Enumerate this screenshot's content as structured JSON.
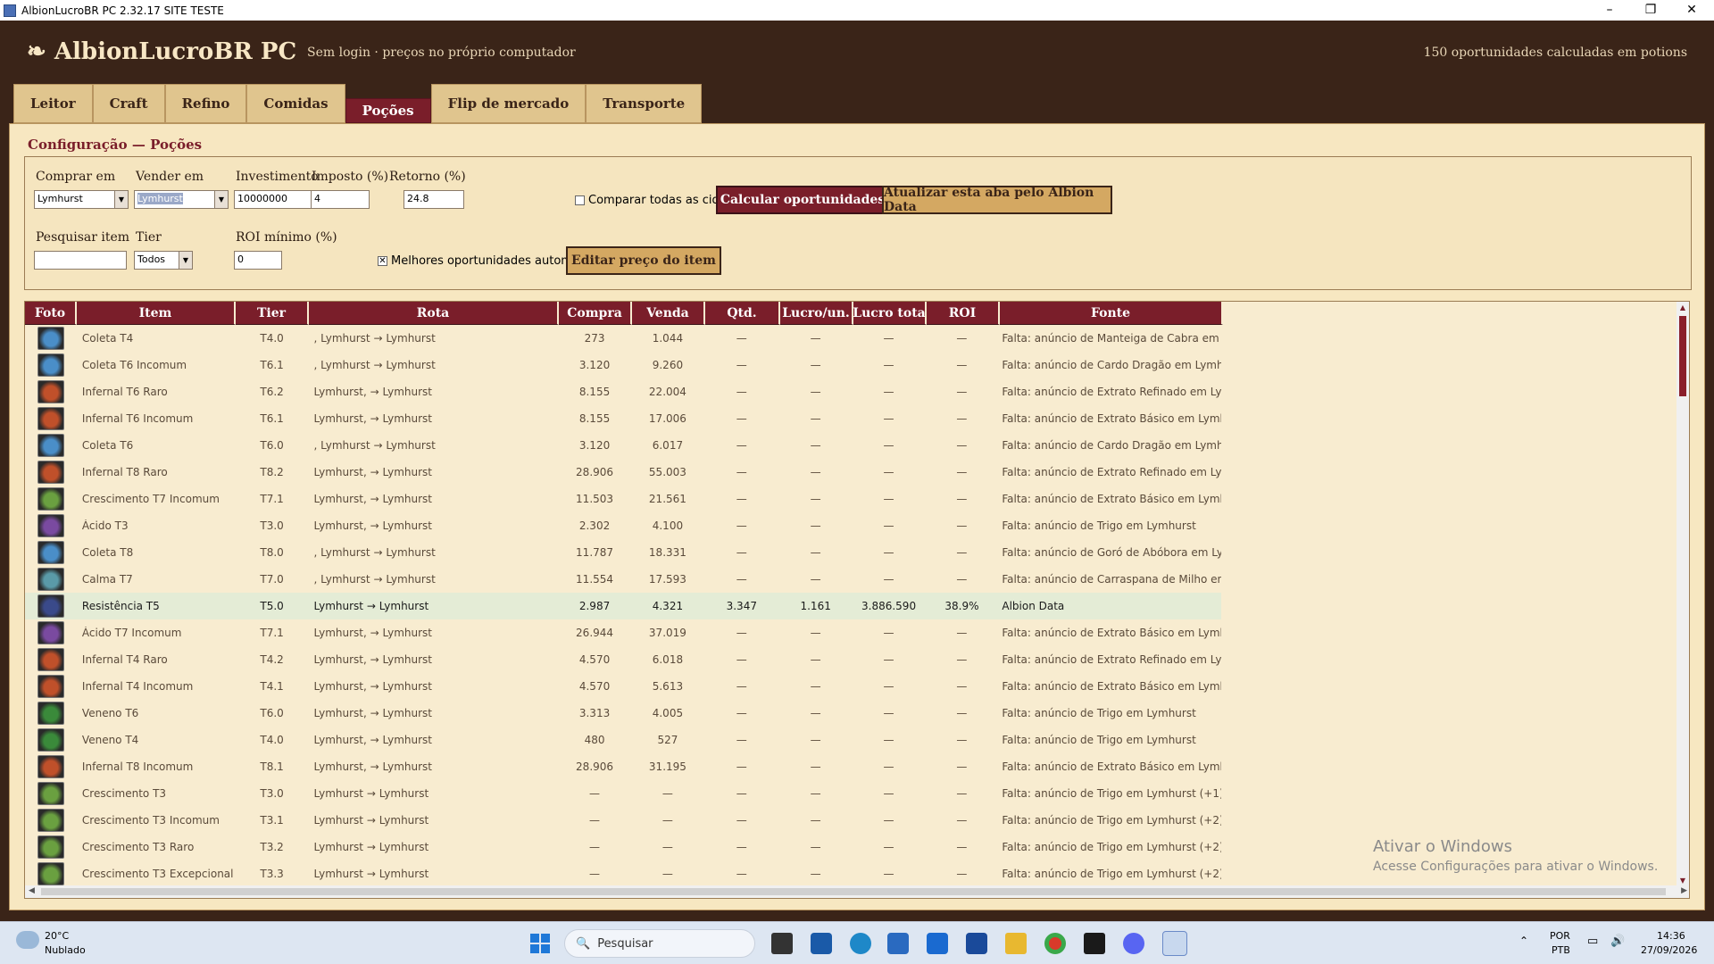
{
  "window": {
    "title": "AlbionLucroBR PC 2.32.17 SITE TESTE"
  },
  "header": {
    "logo": "AlbionLucroBR PC",
    "subtitle": "Sem login · preços no próprio computador",
    "count": "150 oportunidades calculadas em potions"
  },
  "tabs": [
    "Leitor",
    "Craft",
    "Refino",
    "Comidas",
    "Poções",
    "Flip de mercado",
    "Transporte"
  ],
  "active_tab": "Poções",
  "config": {
    "title": "Configuração — Poções",
    "buy_label": "Comprar em",
    "buy_value": "Lymhurst",
    "sell_label": "Vender em",
    "sell_value": "Lymhurst",
    "invest_label": "Investimento",
    "invest_value": "10000000",
    "tax_label": "Imposto (%)",
    "tax_value": "4",
    "return_label": "Retorno (%)",
    "return_value": "24.8",
    "compare_label": "Comparar todas as cidades",
    "calc_button": "Calcular oportunidades",
    "update_button": "Atualizar esta aba pelo Albion Data",
    "search_label": "Pesquisar item",
    "search_value": "",
    "tier_label": "Tier",
    "tier_value": "Todos",
    "roi_label": "ROI mínimo (%)",
    "roi_value": "0",
    "auto_label": "Melhores oportunidades automáticas",
    "auto_checked": true,
    "edit_button": "Editar preço do item"
  },
  "table": {
    "columns": [
      "Foto",
      "Item",
      "Tier",
      "Rota",
      "Compra",
      "Venda",
      "Qtd.",
      "Lucro/un.",
      "Lucro tota",
      "ROI",
      "Fonte"
    ],
    "rows": [
      {
        "icon": "coleta",
        "item": "Coleta T4",
        "tier": "T4.0",
        "rota": ", Lymhurst → Lymhurst",
        "compra": "273",
        "venda": "1.044",
        "qtd": "—",
        "lucro_un": "—",
        "lucro_tot": "—",
        "roi": "—",
        "fonte": "Falta: anúncio de Manteiga de Cabra em"
      },
      {
        "icon": "coleta",
        "item": "Coleta T6 Incomum",
        "tier": "T6.1",
        "rota": ", Lymhurst → Lymhurst",
        "compra": "3.120",
        "venda": "9.260",
        "qtd": "—",
        "lucro_un": "—",
        "lucro_tot": "—",
        "roi": "—",
        "fonte": "Falta: anúncio de Cardo Dragão em Lymh"
      },
      {
        "icon": "infernal",
        "item": "Infernal T6 Raro",
        "tier": "T6.2",
        "rota": "Lymhurst,  → Lymhurst",
        "compra": "8.155",
        "venda": "22.004",
        "qtd": "—",
        "lucro_un": "—",
        "lucro_tot": "—",
        "roi": "—",
        "fonte": "Falta: anúncio de Extrato Refinado em Lyr"
      },
      {
        "icon": "infernal",
        "item": "Infernal T6 Incomum",
        "tier": "T6.1",
        "rota": "Lymhurst,  → Lymhurst",
        "compra": "8.155",
        "venda": "17.006",
        "qtd": "—",
        "lucro_un": "—",
        "lucro_tot": "—",
        "roi": "—",
        "fonte": "Falta: anúncio de Extrato Básico em Lymh"
      },
      {
        "icon": "coleta",
        "item": "Coleta T6",
        "tier": "T6.0",
        "rota": ", Lymhurst → Lymhurst",
        "compra": "3.120",
        "venda": "6.017",
        "qtd": "—",
        "lucro_un": "—",
        "lucro_tot": "—",
        "roi": "—",
        "fonte": "Falta: anúncio de Cardo Dragão em Lymh"
      },
      {
        "icon": "infernal",
        "item": "Infernal T8 Raro",
        "tier": "T8.2",
        "rota": "Lymhurst,  → Lymhurst",
        "compra": "28.906",
        "venda": "55.003",
        "qtd": "—",
        "lucro_un": "—",
        "lucro_tot": "—",
        "roi": "—",
        "fonte": "Falta: anúncio de Extrato Refinado em Lyr"
      },
      {
        "icon": "crescimento",
        "item": "Crescimento T7 Incomum",
        "tier": "T7.1",
        "rota": "Lymhurst,  → Lymhurst",
        "compra": "11.503",
        "venda": "21.561",
        "qtd": "—",
        "lucro_un": "—",
        "lucro_tot": "—",
        "roi": "—",
        "fonte": "Falta: anúncio de Extrato Básico em Lymh"
      },
      {
        "icon": "acido",
        "item": "Ácido T3",
        "tier": "T3.0",
        "rota": "Lymhurst,  → Lymhurst",
        "compra": "2.302",
        "venda": "4.100",
        "qtd": "—",
        "lucro_un": "—",
        "lucro_tot": "—",
        "roi": "—",
        "fonte": "Falta: anúncio de Trigo em Lymhurst"
      },
      {
        "icon": "coleta",
        "item": "Coleta T8",
        "tier": "T8.0",
        "rota": ", Lymhurst → Lymhurst",
        "compra": "11.787",
        "venda": "18.331",
        "qtd": "—",
        "lucro_un": "—",
        "lucro_tot": "—",
        "roi": "—",
        "fonte": "Falta: anúncio de Goró de Abóbora em Ly"
      },
      {
        "icon": "calma",
        "item": "Calma T7",
        "tier": "T7.0",
        "rota": ", Lymhurst → Lymhurst",
        "compra": "11.554",
        "venda": "17.593",
        "qtd": "—",
        "lucro_un": "—",
        "lucro_tot": "—",
        "roi": "—",
        "fonte": "Falta: anúncio de Carraspana de Milho en"
      },
      {
        "icon": "resistencia",
        "item": "Resistência T5",
        "tier": "T5.0",
        "rota": "Lymhurst → Lymhurst",
        "compra": "2.987",
        "venda": "4.321",
        "qtd": "3.347",
        "lucro_un": "1.161",
        "lucro_tot": "3.886.590",
        "roi": "38.9%",
        "fonte": "Albion Data",
        "highlight": true
      },
      {
        "icon": "acido",
        "item": "Ácido T7 Incomum",
        "tier": "T7.1",
        "rota": "Lymhurst,  → Lymhurst",
        "compra": "26.944",
        "venda": "37.019",
        "qtd": "—",
        "lucro_un": "—",
        "lucro_tot": "—",
        "roi": "—",
        "fonte": "Falta: anúncio de Extrato Básico em Lymh"
      },
      {
        "icon": "infernal",
        "item": "Infernal T4 Raro",
        "tier": "T4.2",
        "rota": "Lymhurst,  → Lymhurst",
        "compra": "4.570",
        "venda": "6.018",
        "qtd": "—",
        "lucro_un": "—",
        "lucro_tot": "—",
        "roi": "—",
        "fonte": "Falta: anúncio de Extrato Refinado em Lyr"
      },
      {
        "icon": "infernal",
        "item": "Infernal T4 Incomum",
        "tier": "T4.1",
        "rota": "Lymhurst,  → Lymhurst",
        "compra": "4.570",
        "venda": "5.613",
        "qtd": "—",
        "lucro_un": "—",
        "lucro_tot": "—",
        "roi": "—",
        "fonte": "Falta: anúncio de Extrato Básico em Lymh"
      },
      {
        "icon": "veneno",
        "item": "Veneno T6",
        "tier": "T6.0",
        "rota": "Lymhurst,  → Lymhurst",
        "compra": "3.313",
        "venda": "4.005",
        "qtd": "—",
        "lucro_un": "—",
        "lucro_tot": "—",
        "roi": "—",
        "fonte": "Falta: anúncio de Trigo em Lymhurst"
      },
      {
        "icon": "veneno",
        "item": "Veneno T4",
        "tier": "T4.0",
        "rota": "Lymhurst,  → Lymhurst",
        "compra": "480",
        "venda": "527",
        "qtd": "—",
        "lucro_un": "—",
        "lucro_tot": "—",
        "roi": "—",
        "fonte": "Falta: anúncio de Trigo em Lymhurst"
      },
      {
        "icon": "infernal",
        "item": "Infernal T8 Incomum",
        "tier": "T8.1",
        "rota": "Lymhurst,  → Lymhurst",
        "compra": "28.906",
        "venda": "31.195",
        "qtd": "—",
        "lucro_un": "—",
        "lucro_tot": "—",
        "roi": "—",
        "fonte": "Falta: anúncio de Extrato Básico em Lymh"
      },
      {
        "icon": "crescimento",
        "item": "Crescimento T3",
        "tier": "T3.0",
        "rota": "Lymhurst → Lymhurst",
        "compra": "—",
        "venda": "—",
        "qtd": "—",
        "lucro_un": "—",
        "lucro_tot": "—",
        "roi": "—",
        "fonte": "Falta: anúncio de Trigo em Lymhurst (+1)"
      },
      {
        "icon": "crescimento",
        "item": "Crescimento T3 Incomum",
        "tier": "T3.1",
        "rota": "Lymhurst → Lymhurst",
        "compra": "—",
        "venda": "—",
        "qtd": "—",
        "lucro_un": "—",
        "lucro_tot": "—",
        "roi": "—",
        "fonte": "Falta: anúncio de Trigo em Lymhurst (+2)"
      },
      {
        "icon": "crescimento",
        "item": "Crescimento T3 Raro",
        "tier": "T3.2",
        "rota": "Lymhurst → Lymhurst",
        "compra": "—",
        "venda": "—",
        "qtd": "—",
        "lucro_un": "—",
        "lucro_tot": "—",
        "roi": "—",
        "fonte": "Falta: anúncio de Trigo em Lymhurst (+2)"
      },
      {
        "icon": "crescimento",
        "item": "Crescimento T3 Excepcional",
        "tier": "T3.3",
        "rota": "Lymhurst → Lymhurst",
        "compra": "—",
        "venda": "—",
        "qtd": "—",
        "lucro_un": "—",
        "lucro_tot": "—",
        "roi": "—",
        "fonte": "Falta: anúncio de Trigo em Lymhurst (+2)"
      }
    ]
  },
  "icon_colors": {
    "coleta": "#4a8ec8",
    "infernal": "#c0502a",
    "crescimento": "#6aa040",
    "acido": "#7a4aa0",
    "calma": "#5a9aa8",
    "resistencia": "#3a4a8a",
    "veneno": "#3a8a3a"
  },
  "watermark": {
    "title": "Ativar o Windows",
    "sub": "Acesse Configurações para ativar o Windows."
  },
  "taskbar": {
    "temp": "20°C",
    "weather": "Nublado",
    "search": "Pesquisar",
    "lang1": "POR",
    "lang2": "PTB",
    "time": "14:36",
    "date": "27/09/2026"
  }
}
